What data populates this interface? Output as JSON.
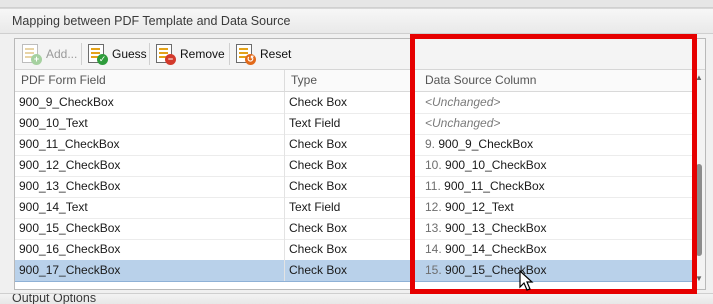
{
  "group": {
    "title": "Mapping between PDF Template and Data Source"
  },
  "toolbar": {
    "add_label": "Add...",
    "guess_label": "Guess",
    "remove_label": "Remove",
    "reset_label": "Reset"
  },
  "grid": {
    "columns": [
      "PDF Form Field",
      "Type",
      "Data Source Column"
    ],
    "rows": [
      {
        "field": "900_9_CheckBox",
        "type": "Check Box",
        "index": "",
        "source": "<Unchanged>"
      },
      {
        "field": "900_10_Text",
        "type": "Text Field",
        "index": "",
        "source": "<Unchanged>"
      },
      {
        "field": "900_11_CheckBox",
        "type": "Check Box",
        "index": "9.",
        "source": "900_9_CheckBox"
      },
      {
        "field": "900_12_CheckBox",
        "type": "Check Box",
        "index": "10.",
        "source": "900_10_CheckBox"
      },
      {
        "field": "900_13_CheckBox",
        "type": "Check Box",
        "index": "11.",
        "source": "900_11_CheckBox"
      },
      {
        "field": "900_14_Text",
        "type": "Text Field",
        "index": "12.",
        "source": "900_12_Text"
      },
      {
        "field": "900_15_CheckBox",
        "type": "Check Box",
        "index": "13.",
        "source": "900_13_CheckBox"
      },
      {
        "field": "900_16_CheckBox",
        "type": "Check Box",
        "index": "14.",
        "source": "900_14_CheckBox"
      },
      {
        "field": "900_17_CheckBox",
        "type": "Check Box",
        "index": "15.",
        "source": "900_15_CheckBox"
      }
    ],
    "selected_row": 8
  },
  "bottom": {
    "title": "Output Options"
  },
  "colors": {
    "selection": "#b9d1ea",
    "highlight": "#e60000",
    "accent": "#e3a21a"
  },
  "icons": [
    "add-icon",
    "guess-icon",
    "remove-icon",
    "reset-icon",
    "mouse-cursor-icon"
  ]
}
